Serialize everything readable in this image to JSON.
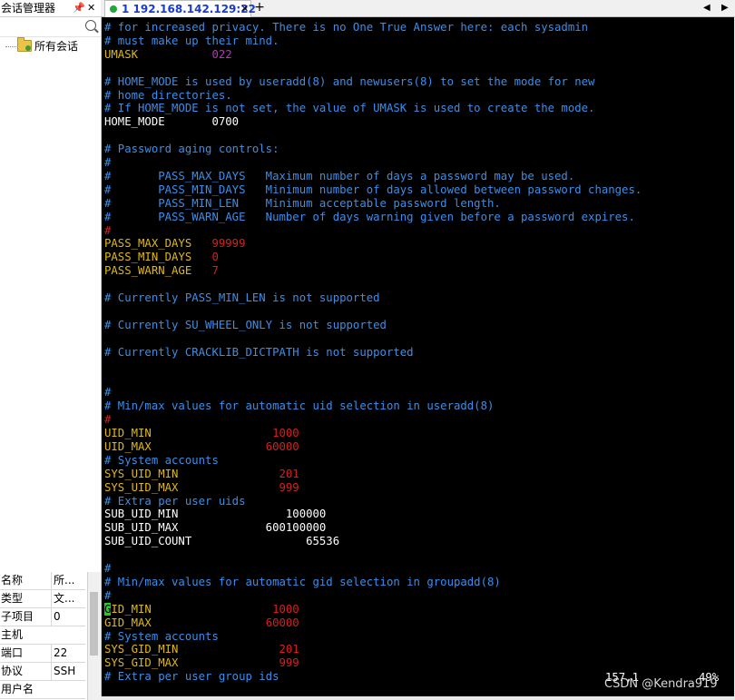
{
  "colors": {
    "comment": "#3b8eea",
    "keyword": "#e0b814",
    "value_red": "#d42020",
    "value_magenta": "#c030c0",
    "plain": "#ffffff",
    "terminal_bg": "#000000",
    "cursor": "#1fd11f"
  },
  "session_panel": {
    "title": "会话管理器",
    "pin_icon": "📌",
    "pin_glyph": "ᵖ",
    "close_glyph": "✕",
    "search_placeholder": "",
    "tree_item_label": "所有会话",
    "tree_item_icon": "folder-icon"
  },
  "properties": [
    {
      "key": "名称",
      "value": "所..."
    },
    {
      "key": "类型",
      "value": "文..."
    },
    {
      "key": "子项目",
      "value": "0"
    },
    {
      "key": "主机",
      "value": ""
    },
    {
      "key": "端口",
      "value": "22"
    },
    {
      "key": "协议",
      "value": "SSH"
    },
    {
      "key": "用户名",
      "value": ""
    }
  ],
  "tabs": {
    "active_label": "1 192.168.142.129:22",
    "close_glyph": "✕",
    "new_tab_glyph": "+",
    "prev_glyph": "◀",
    "next_glyph": "▶"
  },
  "terminal": {
    "lines": [
      {
        "text": "# for increased privacy. There is no One True Answer here: each sysadmin",
        "kind": "comment"
      },
      {
        "text": "# must make up their mind.",
        "kind": "comment"
      },
      {
        "key": "UMASK           ",
        "value": "022",
        "vkind": "value_magenta"
      },
      {
        "text": "",
        "kind": "plain"
      },
      {
        "text": "# HOME_MODE is used by useradd(8) and newusers(8) to set the mode for new",
        "kind": "comment"
      },
      {
        "text": "# home directories.",
        "kind": "comment"
      },
      {
        "text": "# If HOME_MODE is not set, the value of UMASK is used to create the mode.",
        "kind": "comment"
      },
      {
        "text": "HOME_MODE       0700",
        "kind": "plain"
      },
      {
        "text": "",
        "kind": "plain"
      },
      {
        "text": "# Password aging controls:",
        "kind": "comment"
      },
      {
        "text": "#",
        "kind": "comment"
      },
      {
        "text": "#       PASS_MAX_DAYS   Maximum number of days a password may be used.",
        "kind": "comment"
      },
      {
        "text": "#       PASS_MIN_DAYS   Minimum number of days allowed between password changes.",
        "kind": "comment"
      },
      {
        "text": "#       PASS_MIN_LEN    Minimum acceptable password length.",
        "kind": "comment"
      },
      {
        "text": "#       PASS_WARN_AGE   Number of days warning given before a password expires.",
        "kind": "comment"
      },
      {
        "text": "#",
        "kind": "value_red"
      },
      {
        "key": "PASS_MAX_DAYS   ",
        "value": "99999",
        "vkind": "value_red"
      },
      {
        "key": "PASS_MIN_DAYS   ",
        "value": "0",
        "vkind": "value_red"
      },
      {
        "key": "PASS_WARN_AGE   ",
        "value": "7",
        "vkind": "value_red"
      },
      {
        "text": "",
        "kind": "plain"
      },
      {
        "text": "# Currently PASS_MIN_LEN is not supported",
        "kind": "comment"
      },
      {
        "text": "",
        "kind": "plain"
      },
      {
        "text": "# Currently SU_WHEEL_ONLY is not supported",
        "kind": "comment"
      },
      {
        "text": "",
        "kind": "plain"
      },
      {
        "text": "# Currently CRACKLIB_DICTPATH is not supported",
        "kind": "comment"
      },
      {
        "text": "",
        "kind": "plain"
      },
      {
        "text": "",
        "kind": "plain"
      },
      {
        "text": "#",
        "kind": "comment"
      },
      {
        "text": "# Min/max values for automatic uid selection in useradd(8)",
        "kind": "comment"
      },
      {
        "text": "#",
        "kind": "value_red"
      },
      {
        "key": "UID_MIN                  ",
        "value": "1000",
        "vkind": "value_red"
      },
      {
        "key": "UID_MAX                 ",
        "value": "60000",
        "vkind": "value_red"
      },
      {
        "text": "# System accounts",
        "kind": "comment"
      },
      {
        "key": "SYS_UID_MIN               ",
        "value": "201",
        "vkind": "value_red"
      },
      {
        "key": "SYS_UID_MAX               ",
        "value": "999",
        "vkind": "value_red"
      },
      {
        "text": "# Extra per user uids",
        "kind": "comment"
      },
      {
        "text": "SUB_UID_MIN                100000",
        "kind": "plain"
      },
      {
        "text": "SUB_UID_MAX             600100000",
        "kind": "plain"
      },
      {
        "text": "SUB_UID_COUNT                 65536",
        "kind": "plain"
      },
      {
        "text": "",
        "kind": "plain"
      },
      {
        "text": "#",
        "kind": "comment"
      },
      {
        "text": "# Min/max values for automatic gid selection in groupadd(8)",
        "kind": "comment"
      },
      {
        "text": "#",
        "kind": "comment"
      },
      {
        "key": "GID_MIN                  ",
        "value": "1000",
        "vkind": "value_red",
        "cursor": true
      },
      {
        "key": "GID_MAX                 ",
        "value": "60000",
        "vkind": "value_red"
      },
      {
        "text": "# System accounts",
        "kind": "comment"
      },
      {
        "key": "SYS_GID_MIN               ",
        "value": "201",
        "vkind": "value_red"
      },
      {
        "key": "SYS_GID_MAX               ",
        "value": "999",
        "vkind": "value_red"
      },
      {
        "text": "# Extra per user group ids",
        "kind": "comment"
      }
    ],
    "status_position": "157,1",
    "status_percent": "49%",
    "watermark": "CSDN @Kendra919"
  }
}
